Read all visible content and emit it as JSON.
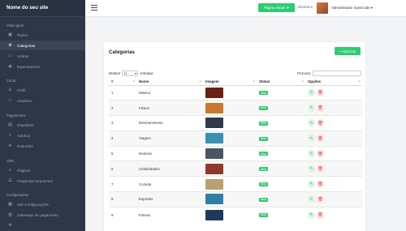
{
  "brand": "Nome do seu site",
  "sidebar": {
    "sections": [
      {
        "title": "Visão geral",
        "items": [
          {
            "label": "Painel",
            "icon": "dashboard-icon",
            "glyph": "▣",
            "active": false
          },
          {
            "label": "Categorias",
            "icon": "gear-icon",
            "glyph": "⚙",
            "active": true
          },
          {
            "label": "Vídeos",
            "icon": "video-icon",
            "glyph": "▭",
            "active": false
          },
          {
            "label": "Espectadores",
            "icon": "eye-icon",
            "glyph": "◉",
            "active": false
          }
        ]
      },
      {
        "title": "Conta",
        "items": [
          {
            "label": "Perfil",
            "icon": "user-icon",
            "glyph": "♙",
            "active": false
          },
          {
            "label": "Usuários",
            "icon": "users-icon",
            "glyph": "⚇",
            "active": false
          }
        ]
      },
      {
        "title": "Pagamentos",
        "items": [
          {
            "label": "Depósitos",
            "icon": "card-icon",
            "glyph": "▤",
            "active": false
          },
          {
            "label": "Ganhos",
            "icon": "chart-icon",
            "glyph": "∿",
            "active": false
          },
          {
            "label": "Retirados",
            "icon": "send-icon",
            "glyph": "➤",
            "active": false
          }
        ]
      },
      {
        "title": "CMS",
        "items": [
          {
            "label": "Páginas",
            "icon": "pages-icon",
            "glyph": "≡",
            "active": false
          },
          {
            "label": "Perguntas frequentes",
            "icon": "list-icon",
            "glyph": "☰",
            "active": false
          }
        ]
      },
      {
        "title": "Configurações",
        "items": [
          {
            "label": "Site Configurações",
            "icon": "site-settings-icon",
            "glyph": "▦",
            "active": false
          },
          {
            "label": "Gateways de pagamento",
            "icon": "payment-gateway-icon",
            "glyph": "▥",
            "active": false
          },
          {
            "label": "",
            "icon": "cog-icon",
            "glyph": "✲",
            "active": false
          }
        ]
      }
    ]
  },
  "topbar": {
    "home_button": "Página Inicial",
    "language": "Idiomas",
    "user_name": "Administrador ApexCode"
  },
  "card": {
    "title": "Categorias",
    "add_button": "+ Adicionar",
    "length_prefix": "Mostrar",
    "length_value": "10",
    "length_suffix": "entradas",
    "search_label": "Procurar:"
  },
  "table": {
    "headers": [
      "#",
      "Nome",
      "Imagem",
      "Status",
      "Opções"
    ],
    "rows": [
      {
        "id": "1",
        "name": "Música",
        "image_color": "#6a1f12",
        "status": "Ativo"
      },
      {
        "id": "2",
        "name": "Filmes",
        "image_color": "#c8782e",
        "status": "Ativo"
      },
      {
        "id": "3",
        "name": "Entretenimento",
        "image_color": "#2f3a48",
        "status": "Ativo"
      },
      {
        "id": "4",
        "name": "Viagem",
        "image_color": "#3a8fb5",
        "status": "Ativo"
      },
      {
        "id": "5",
        "name": "Notícias",
        "image_color": "#4a5564",
        "status": "Ativo"
      },
      {
        "id": "6",
        "name": "Celebridades",
        "image_color": "#8e3a2a",
        "status": "Ativo"
      },
      {
        "id": "7",
        "name": "Comida",
        "image_color": "#b8a070",
        "status": "Ativo"
      },
      {
        "id": "8",
        "name": "Esportes",
        "image_color": "#2e7fa8",
        "status": "Ativo"
      },
      {
        "id": "9",
        "name": "Fitness",
        "image_color": "#1e3a5a",
        "status": "Ativo"
      }
    ]
  },
  "colors": {
    "sidebar": "#2d3748",
    "accent": "#2ecc71",
    "danger": "#e74c3c"
  }
}
